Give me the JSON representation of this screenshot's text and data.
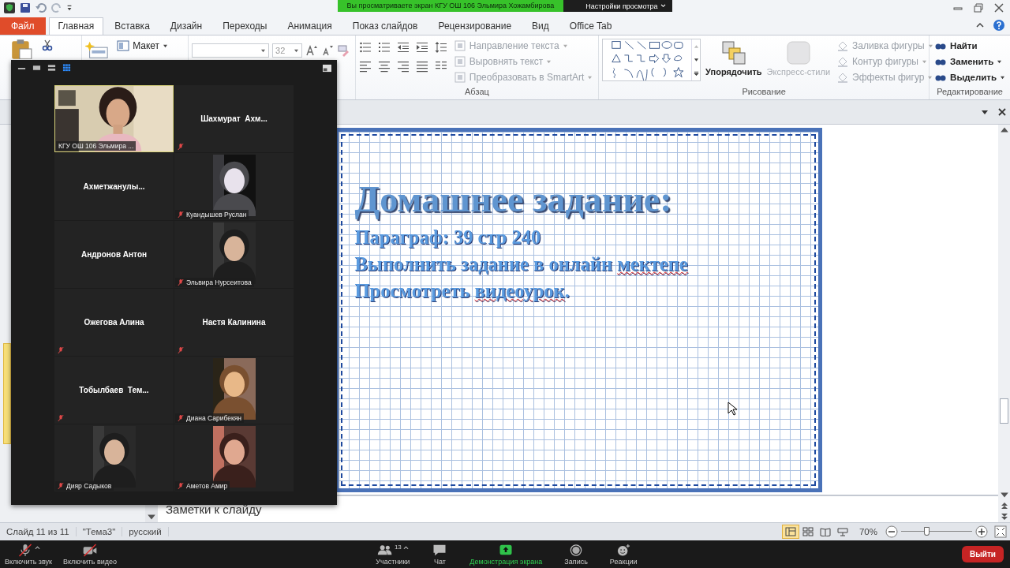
{
  "title_bar": {
    "share_banner": "Вы просматриваете экран КГУ ОШ 106 Эльмира Хожамбирова",
    "view_options": "Настройки просмотра"
  },
  "ribbon_tabs": [
    {
      "label": "Файл",
      "kind": "file",
      "selected": false
    },
    {
      "label": "Главная",
      "kind": "tab",
      "selected": true
    },
    {
      "label": "Вставка",
      "kind": "tab",
      "selected": false
    },
    {
      "label": "Дизайн",
      "kind": "tab",
      "selected": false
    },
    {
      "label": "Переходы",
      "kind": "tab",
      "selected": false
    },
    {
      "label": "Анимация",
      "kind": "tab",
      "selected": false
    },
    {
      "label": "Показ слайдов",
      "kind": "tab",
      "selected": false
    },
    {
      "label": "Рецензирование",
      "kind": "tab",
      "selected": false
    },
    {
      "label": "Вид",
      "kind": "tab",
      "selected": false
    },
    {
      "label": "Office Tab",
      "kind": "tab",
      "selected": false
    }
  ],
  "ribbon": {
    "slides": {
      "layout": "Макет"
    },
    "font": {
      "size": "32"
    },
    "paragraph": {
      "label": "Абзац",
      "commands": [
        {
          "label": "Направление текста",
          "disabled": true
        },
        {
          "label": "Выровнять текст",
          "disabled": true
        },
        {
          "label": "Преобразовать в SmartArt",
          "disabled": true
        }
      ]
    },
    "drawing": {
      "label": "Рисование",
      "arrange": {
        "label": "Упорядочить",
        "disabled": false
      },
      "quick_styles": {
        "label": "Экспресс-стили",
        "disabled": true
      },
      "commands": [
        {
          "label": "Заливка фигуры",
          "disabled": true
        },
        {
          "label": "Контур фигуры",
          "disabled": true
        },
        {
          "label": "Эффекты фигур",
          "disabled": true
        }
      ]
    },
    "editing": {
      "label": "Редактирование",
      "commands": [
        {
          "label": "Найти",
          "dropdown": false
        },
        {
          "label": "Заменить",
          "dropdown": true
        },
        {
          "label": "Выделить",
          "dropdown": true
        }
      ]
    }
  },
  "slide": {
    "title": "Домашнее задание:",
    "lines": [
      {
        "segments": [
          {
            "text": "Параграф: 39 стр 240",
            "misspelled": false
          }
        ]
      },
      {
        "segments": [
          {
            "text": "Выполнить задание в онлайн ",
            "misspelled": false
          },
          {
            "text": "мектепе",
            "misspelled": true
          }
        ]
      },
      {
        "segments": [
          {
            "text": "Просмотреть ",
            "misspelled": false
          },
          {
            "text": "видеоурок",
            "misspelled": true
          },
          {
            "text": ".",
            "misspelled": false
          }
        ]
      }
    ]
  },
  "notes": {
    "placeholder": "Заметки к слайду"
  },
  "status_bar": {
    "items": [
      "Слайд 11 из 11",
      "\"Тема3\"",
      "русский"
    ],
    "views": [
      {
        "kind": "normal",
        "selected": true
      },
      {
        "kind": "sorter",
        "selected": false
      },
      {
        "kind": "reading",
        "selected": false
      },
      {
        "kind": "slideshow",
        "selected": false
      }
    ],
    "zoom": "70%",
    "zoom_slider": {
      "level": 0.36
    }
  },
  "meeting_panel": {
    "layouts": [
      {
        "kind": "minimize",
        "selected": false
      },
      {
        "kind": "speaker",
        "selected": false
      },
      {
        "kind": "strip",
        "selected": false
      },
      {
        "kind": "gallery",
        "selected": true
      }
    ],
    "tiles": [
      {
        "name": "КГУ ОШ 106 Эльмира ...",
        "kind": "video",
        "muted": false,
        "speaking": true
      },
      {
        "name": "Шахмурат  Ахм...",
        "kind": "name",
        "muted": true,
        "speaking": false
      },
      {
        "name": "Ахметжанулы...",
        "kind": "name",
        "muted": false,
        "speaking": false
      },
      {
        "name": "Куандышев Руслан",
        "muted": true,
        "speaking": false
      },
      {
        "name": "Андронов Антон",
        "kind": "name",
        "muted": false,
        "speaking": false
      },
      {
        "name": "Эльвира Нурсеитова",
        "muted": true,
        "speaking": false
      },
      {
        "name": "Ожегова Алина",
        "kind": "name",
        "muted": true,
        "speaking": false
      },
      {
        "name": "Настя Калинина",
        "kind": "name",
        "muted": true,
        "speaking": false
      },
      {
        "name": "Тобылбаев  Тем...",
        "kind": "name",
        "muted": true,
        "speaking": false
      },
      {
        "name": "Диана Сарибекян",
        "muted": true,
        "speaking": false
      },
      {
        "name": "Дияр Садыков",
        "muted": true,
        "speaking": false
      },
      {
        "name": "Аметов Амир",
        "muted": true,
        "speaking": false
      }
    ]
  },
  "meeting_toolbar": {
    "buttons": [
      {
        "label": "Включить звук",
        "kind": "mic",
        "off": true,
        "menu": true,
        "active": false
      },
      {
        "label": "Включить видео",
        "kind": "camera",
        "off": true,
        "menu": false,
        "active": false
      },
      {
        "label": "Участники",
        "kind": "participants",
        "count": "13",
        "off": false,
        "menu": true,
        "active": false
      },
      {
        "label": "Чат",
        "kind": "chat",
        "off": false,
        "menu": false,
        "active": false
      },
      {
        "label": "Демонстрация экрана",
        "kind": "share",
        "off": false,
        "menu": false,
        "active": true
      },
      {
        "label": "Запись",
        "kind": "record",
        "off": false,
        "menu": false,
        "active": false
      },
      {
        "label": "Реакции",
        "kind": "reactions",
        "off": false,
        "menu": false,
        "active": false
      }
    ],
    "leave": "Выйти"
  }
}
